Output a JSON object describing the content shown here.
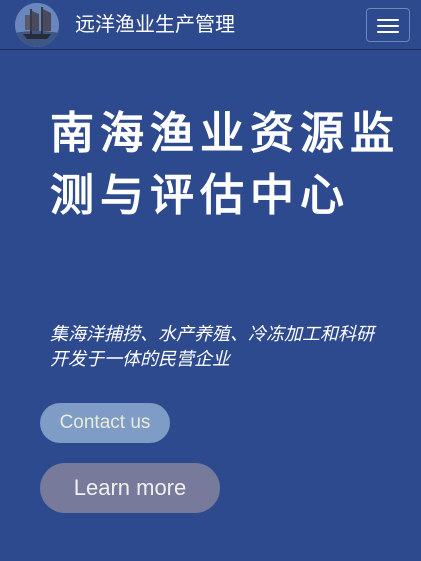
{
  "navbar": {
    "brand": "远洋渔业生产管理",
    "logo_icon": "sailing-ship-icon",
    "menu_icon": "hamburger-menu-icon"
  },
  "hero": {
    "title": "南海渔业资源监测与评估中心",
    "subtitle": "集海洋捕捞、水产养殖、冷冻加工和科研开发于一体的民营企业",
    "contact_label": "Contact us",
    "learn_more_label": "Learn more"
  },
  "colors": {
    "background": "#2e4a8e",
    "contact_button": "#7f9cc6",
    "learn_more_button": "#777a9a",
    "text": "#ffffff"
  }
}
